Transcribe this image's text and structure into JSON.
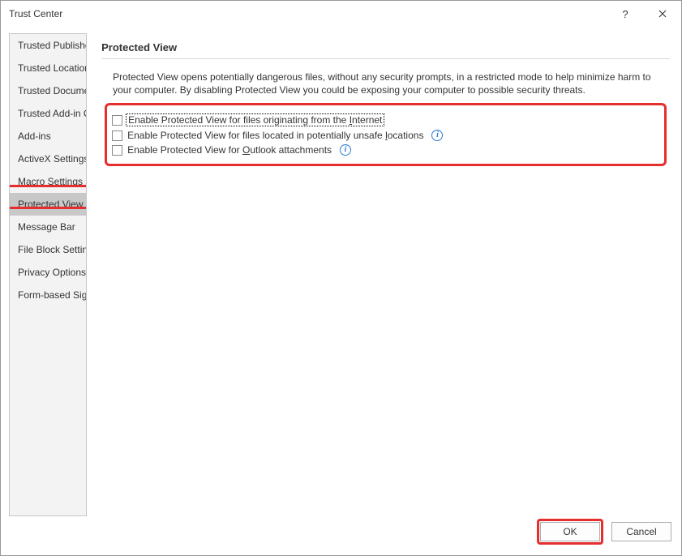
{
  "window": {
    "title": "Trust Center"
  },
  "sidebar": {
    "items": [
      {
        "label": "Trusted Publishers"
      },
      {
        "label": "Trusted Locations"
      },
      {
        "label": "Trusted Documents"
      },
      {
        "label": "Trusted Add-in Catalogs"
      },
      {
        "label": "Add-ins"
      },
      {
        "label": "ActiveX Settings"
      },
      {
        "label": "Macro Settings"
      },
      {
        "label": "Protected View",
        "selected": true
      },
      {
        "label": "Message Bar"
      },
      {
        "label": "File Block Settings"
      },
      {
        "label": "Privacy Options"
      },
      {
        "label": "Form-based Sign-in"
      }
    ]
  },
  "main": {
    "header": "Protected View",
    "description": "Protected View opens potentially dangerous files, without any security prompts, in a restricted mode to help minimize harm to your computer. By disabling Protected View you could be exposing your computer to possible security threats.",
    "options": [
      {
        "pre": "Enable Protected View for files originating from the ",
        "accel": "I",
        "post": "nternet",
        "focused": true,
        "info": false,
        "checked": false
      },
      {
        "pre": "Enable Protected View for files located in potentially unsafe ",
        "accel": "l",
        "post": "ocations",
        "focused": false,
        "info": true,
        "checked": false
      },
      {
        "pre": "Enable Protected View for ",
        "accel": "O",
        "post": "utlook attachments",
        "focused": false,
        "info": true,
        "checked": false
      }
    ]
  },
  "footer": {
    "ok": "OK",
    "cancel": "Cancel"
  }
}
